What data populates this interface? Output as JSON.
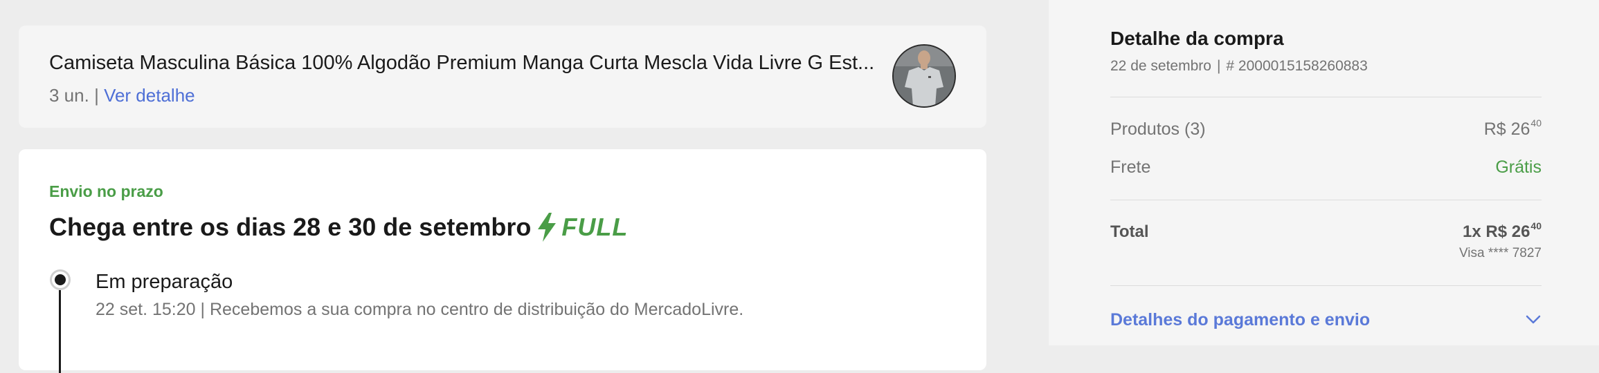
{
  "product": {
    "title": "Camiseta Masculina Básica 100% Algodão Premium Manga Curta Mescla Vida Livre G Est...",
    "quantity": "3 un.",
    "separator": "|",
    "detail_link": "Ver detalhe",
    "thumb_icon": "product-thumbnail-shirt"
  },
  "shipment": {
    "status": "Envio no prazo",
    "heading_prefix": "Chega entre os dias",
    "day_from": "28",
    "heading_and": "e",
    "day_to": "30",
    "heading_suffix": "de setembro",
    "badge": "FULL",
    "badge_icon": "lightning-bolt-icon",
    "step": {
      "title": "Em preparação",
      "time": "22 set. 15:20",
      "separator": "|",
      "description": "Recebemos a sua compra no centro de distribuição do MercadoLivre."
    }
  },
  "summary": {
    "title": "Detalhe da compra",
    "date": "22 de setembro",
    "separator": "|",
    "order_number": "# 2000015158260883",
    "products_label": "Produtos (3)",
    "products_value_main": "R$ 26",
    "products_value_cents": "40",
    "shipping_label": "Frete",
    "shipping_value": "Grátis",
    "total_label": "Total",
    "total_value_main": "1x R$ 26",
    "total_value_cents": "40",
    "card": "Visa **** 7827",
    "payment_link": "Detalhes do pagamento e envio",
    "chevron_icon": "chevron-down-icon"
  },
  "colors": {
    "link": "#4e6fd6",
    "success": "#4a9d47",
    "background_left": "#ededed",
    "background_right": "#f5f5f5"
  }
}
